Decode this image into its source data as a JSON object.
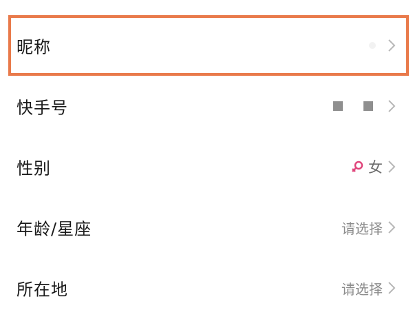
{
  "profile_rows": [
    {
      "label": "昵称",
      "value": ""
    },
    {
      "label": "快手号",
      "value": ""
    },
    {
      "label": "性别",
      "value": "女"
    },
    {
      "label": "年龄/星座",
      "value": "请选择"
    },
    {
      "label": "所在地",
      "value": "请选择"
    }
  ],
  "colors": {
    "highlight_border": "#e97a4b",
    "female_symbol": "#e0457b"
  },
  "icons": {
    "row_arrow": "chevron-right-icon",
    "gender": "female-symbol-icon"
  }
}
